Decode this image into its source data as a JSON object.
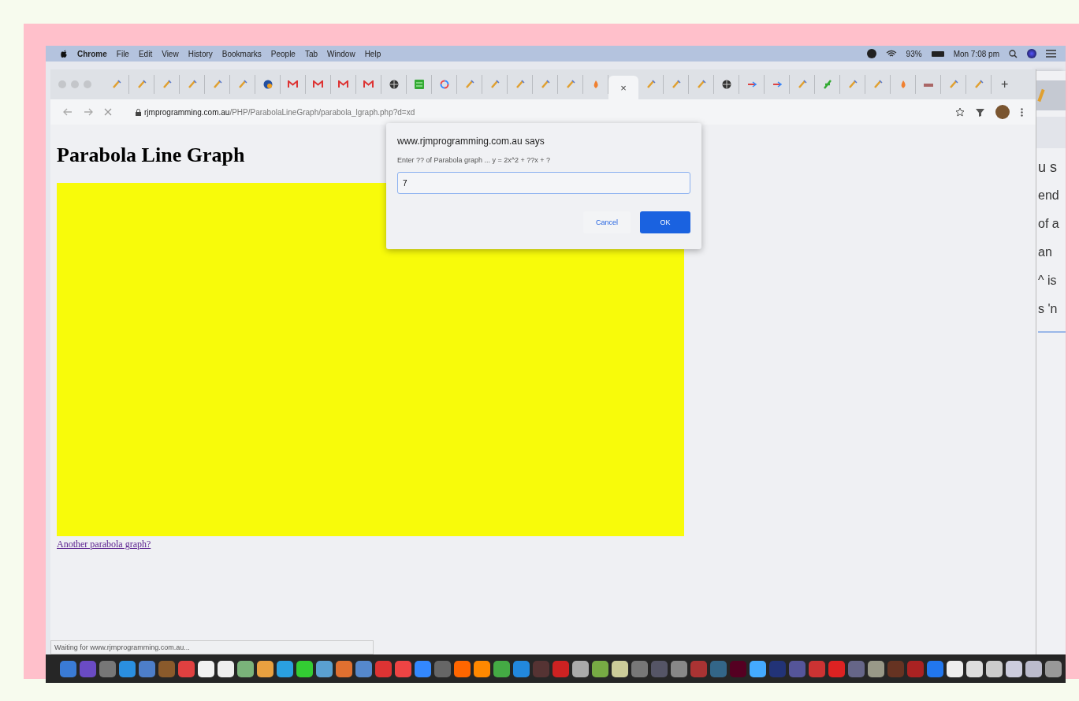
{
  "menu_bar": {
    "items": [
      "Chrome",
      "File",
      "Edit",
      "View",
      "History",
      "Bookmarks",
      "People",
      "Tab",
      "Window",
      "Help"
    ],
    "battery": "93%",
    "clock": "Mon 7:08 pm"
  },
  "tabs": [
    {
      "kind": "pencil",
      "selected": false
    },
    {
      "kind": "pencil",
      "selected": false
    },
    {
      "kind": "pencil",
      "selected": false
    },
    {
      "kind": "pencil",
      "selected": false
    },
    {
      "kind": "pencil",
      "selected": false
    },
    {
      "kind": "pencil",
      "selected": false
    },
    {
      "kind": "blue",
      "selected": false
    },
    {
      "kind": "mail",
      "selected": false
    },
    {
      "kind": "mail",
      "selected": false
    },
    {
      "kind": "mail",
      "selected": false
    },
    {
      "kind": "mail",
      "selected": false
    },
    {
      "kind": "globe",
      "selected": false
    },
    {
      "kind": "sheet",
      "selected": false
    },
    {
      "kind": "color",
      "selected": false
    },
    {
      "kind": "pencil",
      "selected": false
    },
    {
      "kind": "pencil",
      "selected": false
    },
    {
      "kind": "pencil",
      "selected": false
    },
    {
      "kind": "pencil",
      "selected": false
    },
    {
      "kind": "pencil",
      "selected": false
    },
    {
      "kind": "orange",
      "selected": false
    },
    {
      "selected": true,
      "close": "×"
    },
    {
      "kind": "pencil",
      "selected": false
    },
    {
      "kind": "pencil",
      "selected": false
    },
    {
      "kind": "pencil",
      "selected": false
    },
    {
      "kind": "globe",
      "selected": false
    },
    {
      "kind": "arrow",
      "selected": false
    },
    {
      "kind": "arrow",
      "selected": false
    },
    {
      "kind": "pencil",
      "selected": false
    },
    {
      "kind": "green",
      "selected": false
    },
    {
      "kind": "pencil",
      "selected": false
    },
    {
      "kind": "pencil",
      "selected": false
    },
    {
      "kind": "orange",
      "selected": false
    },
    {
      "kind": "bar",
      "selected": false
    },
    {
      "kind": "pencil",
      "selected": false
    },
    {
      "kind": "pencil",
      "selected": false
    }
  ],
  "new_tab": "+",
  "address_bar": {
    "domain": "rjmprogramming.com.au",
    "path": "/PHP/ParabolaLineGraph/parabola_lgraph.php?d=xd"
  },
  "page": {
    "heading": "Parabola Line Graph",
    "link": "Another parabola graph?"
  },
  "dialog": {
    "title": "www.rjmprogramming.com.au says",
    "message": "Enter ?? of Parabola graph ... y = 2x^2 + ??x + ?",
    "value": "7",
    "buttons": [
      {
        "label": "Cancel",
        "kind": "secondary"
      },
      {
        "label": "OK",
        "kind": "primary"
      }
    ]
  },
  "status_bar": "Waiting for www.rjmprogramming.com.au...",
  "background_window": {
    "lines": [
      "u s",
      "end",
      "of a",
      "an",
      "^ is",
      "s 'n"
    ]
  }
}
